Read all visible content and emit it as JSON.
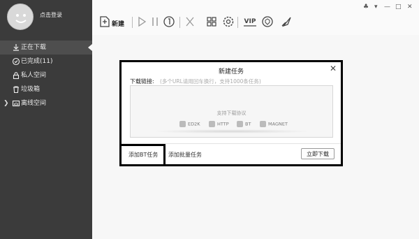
{
  "sidebar": {
    "login_label": "点击登录",
    "items": [
      {
        "label": "正在下载",
        "icon": "download-icon",
        "active": true
      },
      {
        "label": "已完成(11)",
        "icon": "check-circle-icon"
      },
      {
        "label": "私人空间",
        "icon": "lock-icon"
      },
      {
        "label": "垃圾箱",
        "icon": "trash-icon"
      },
      {
        "label": "离线空间",
        "icon": "cloud-folder-icon",
        "expandable": true
      }
    ]
  },
  "toolbar": {
    "new_label": "新建",
    "buttons": [
      "new-icon",
      "play-icon",
      "pause-icon",
      "speed-icon",
      "delete-icon",
      "grid-icon",
      "settings-icon",
      "vip-icon",
      "shield-icon",
      "rocket-icon"
    ],
    "vip_label": "VIP"
  },
  "dialog": {
    "title": "新建任务",
    "close_label": "✕",
    "url_label": "下载链接:",
    "url_hint": "(多个URL请用回车换行，支持1000条任务)",
    "protocols_title": "支持下载协议",
    "protocols": [
      "ED2K",
      "HTTP",
      "BT",
      "MAGNET"
    ],
    "add_bt_label": "添加BT任务",
    "add_batch_label": "添加批量任务",
    "start_label": "立即下载"
  },
  "colors": {
    "sidebar_bg": "#3b3b3b",
    "highlight_border": "#000000"
  }
}
